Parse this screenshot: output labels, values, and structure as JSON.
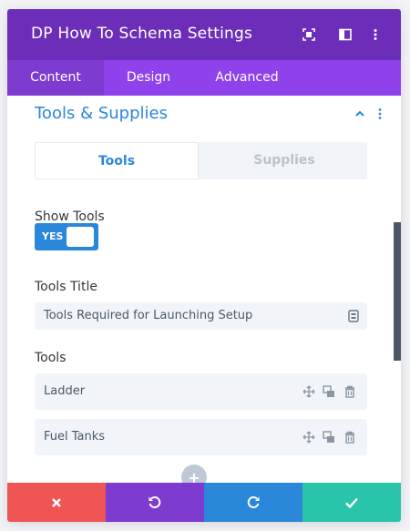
{
  "header": {
    "title": "DP How To Schema Settings",
    "icons": [
      "expand-icon",
      "columns-icon",
      "more-vertical-icon"
    ]
  },
  "tabs": [
    {
      "label": "Content",
      "active": true
    },
    {
      "label": "Design",
      "active": false
    },
    {
      "label": "Advanced",
      "active": false
    }
  ],
  "section": {
    "title": "Tools & Supplies",
    "icons": [
      "chevron-up-icon",
      "more-vertical-icon"
    ]
  },
  "subtabs": [
    {
      "label": "Tools",
      "active": true
    },
    {
      "label": "Supplies",
      "active": false
    }
  ],
  "show_tools": {
    "label": "Show Tools",
    "toggle_text": "YES",
    "value": true
  },
  "tools_title": {
    "label": "Tools Title",
    "value": "Tools Required for Launching Setup",
    "icon": "dynamic-content-icon"
  },
  "tools": {
    "label": "Tools",
    "items": [
      {
        "label": "Ladder"
      },
      {
        "label": "Fuel Tanks"
      }
    ],
    "item_icons": [
      "move-icon",
      "duplicate-icon",
      "trash-icon"
    ]
  },
  "footer": {
    "buttons": [
      {
        "name": "cancel",
        "icon": "close-icon",
        "color": "#ef5555"
      },
      {
        "name": "undo",
        "icon": "undo-icon",
        "color": "#7e3bd0"
      },
      {
        "name": "redo",
        "icon": "redo-icon",
        "color": "#2b87da"
      },
      {
        "name": "save",
        "icon": "check-icon",
        "color": "#29c4a9"
      }
    ]
  },
  "colors": {
    "header": "#6c2eb9",
    "tabs": "#8f42ec",
    "accent": "#2b87da"
  }
}
